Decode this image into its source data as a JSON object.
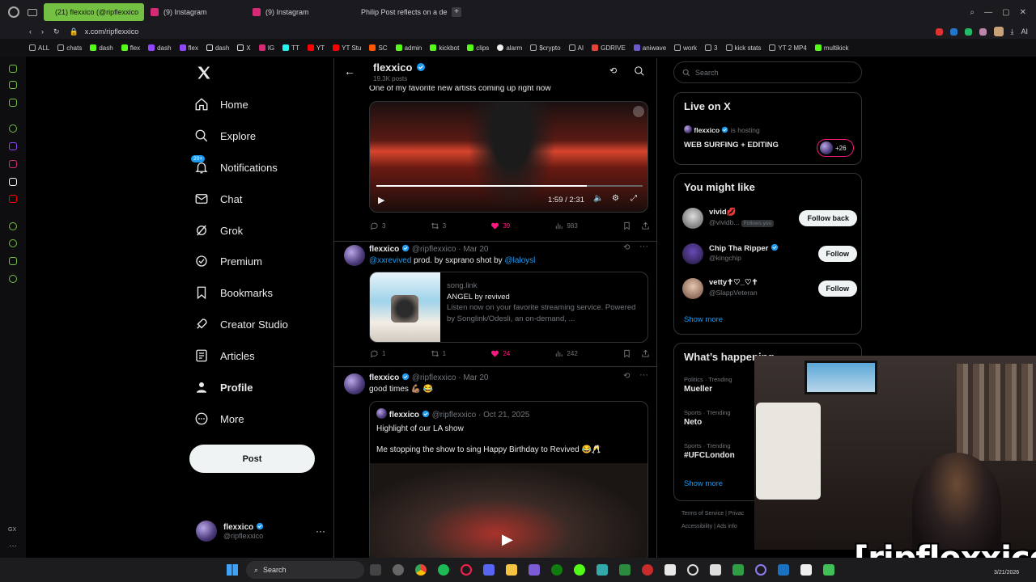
{
  "browser": {
    "tabs": [
      {
        "label": "(21) flexxico (@ripflexxico",
        "active": true,
        "color": "#000000"
      },
      {
        "label": "(9) Instagram",
        "active": false,
        "color": "#d62976"
      },
      {
        "label": "(9) Instagram",
        "active": false,
        "color": "#d62976"
      },
      {
        "label": "Philip Post reflects on a de",
        "active": false,
        "color": "#3b5bdb"
      }
    ],
    "url": "x.com/ripflexxico",
    "aria_label": "AI",
    "bookmarks": [
      "ALL",
      "chats",
      "dash",
      "flex",
      "dash",
      "flex",
      "dash",
      "X",
      "IG",
      "TT",
      "YT",
      "YT Stu",
      "SC",
      "admin",
      "kickbot",
      "clips",
      "alarm",
      "$crypto",
      "AI",
      "GDRIVE",
      "aniwave",
      "work",
      "3",
      "kick stats",
      "YT 2 MP4",
      "multikick"
    ]
  },
  "nav": {
    "items": [
      {
        "label": "Home",
        "icon": "home-icon"
      },
      {
        "label": "Explore",
        "icon": "search-icon"
      },
      {
        "label": "Notifications",
        "icon": "bell-icon"
      },
      {
        "label": "Chat",
        "icon": "mail-icon"
      },
      {
        "label": "Grok",
        "icon": "grok-icon"
      },
      {
        "label": "Premium",
        "icon": "premium-icon"
      },
      {
        "label": "Bookmarks",
        "icon": "bookmark-icon"
      },
      {
        "label": "Creator Studio",
        "icon": "rocket-icon"
      },
      {
        "label": "Articles",
        "icon": "article-icon"
      },
      {
        "label": "Profile",
        "icon": "profile-icon"
      },
      {
        "label": "More",
        "icon": "more-icon"
      }
    ],
    "notif_badge": "20+",
    "post_label": "Post",
    "account": {
      "name": "flexxico",
      "handle": "@ripflexxico"
    }
  },
  "profile_header": {
    "name": "flexxico",
    "posts": "19.3K posts"
  },
  "posts": [
    {
      "text": "One of my favorite new artists coming up right now",
      "video_time": "1:59 / 2:31",
      "video_progress": 0.79,
      "replies": "3",
      "reposts": "3",
      "likes": "39",
      "views": "983"
    },
    {
      "name": "flexxico",
      "handle": "@ripflexxico",
      "date": "Mar 20",
      "mention1": "@xxrevived",
      "text_mid": " prod. by sxprano shot by ",
      "mention2": "@laloysl",
      "card_domain": "song.link",
      "card_title": "ANGEL by revived",
      "card_desc": "Listen now on your favorite streaming service. Powered by Songlink/Odesli, an on-demand, ...",
      "replies": "1",
      "reposts": "1",
      "likes": "24",
      "views": "242"
    },
    {
      "name": "flexxico",
      "handle": "@ripflexxico",
      "date": "Mar 20",
      "text": "good times 💪🏽 😂",
      "quote": {
        "name": "flexxico",
        "handle": "@ripflexxico",
        "date": "Oct 21, 2025",
        "line1": "Highlight of our LA show",
        "line2": "Me stopping the show to sing Happy Birthday to Revived 😂🥂"
      }
    }
  ],
  "sidebar": {
    "search_placeholder": "Search",
    "live": {
      "title": "Live on X",
      "host": "flexxico",
      "hosting_text": "is hosting",
      "stream": "WEB SURFING + EDITING",
      "count": "+26"
    },
    "might_like": {
      "title": "You might like",
      "users": [
        {
          "name": "vivid💋",
          "handle": "@vividb...",
          "follows_you": "Follows you",
          "button": "Follow back"
        },
        {
          "name": "Chip Tha Ripper",
          "handle": "@kingchip",
          "button": "Follow"
        },
        {
          "name": "vetty✝♡_♡✝",
          "handle": "@SlappVeteran",
          "button": "Follow"
        }
      ],
      "show_more": "Show more"
    },
    "happening": {
      "title": "What’s happening",
      "trends": [
        {
          "category": "Politics · Trending",
          "name": "Mueller"
        },
        {
          "category": "Sports · Trending",
          "name": "Neto"
        },
        {
          "category": "Sports · Trending",
          "name": "#UFCLondon"
        }
      ],
      "show_more": "Show more"
    },
    "footer": {
      "terms": "Terms of Service",
      "privacy": "Privac",
      "accessibility": "Accessibility",
      "ads": "Ads info"
    }
  },
  "taskbar": {
    "search": "Search",
    "date": "3/21/2026"
  },
  "overlay": {
    "name": "[ripflexxico]"
  },
  "colors": {
    "accent": "#1d9bf0",
    "like": "#f91880",
    "opera_green": "#74c043"
  }
}
